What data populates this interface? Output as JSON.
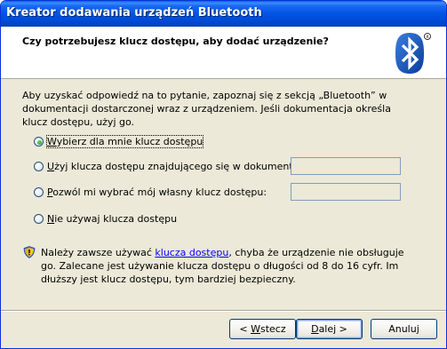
{
  "window": {
    "title": "Kreator dodawania urządzeń Bluetooth"
  },
  "header": {
    "title": "Czy potrzebujesz klucz dostępu, aby dodać urządzenie?",
    "logo_icon": "bluetooth-logo-icon"
  },
  "intro": "Aby uzyskać odpowiedź na to pytanie, zapoznaj się z sekcją „Bluetooth” w dokumentacji dostarczonej wraz z urządzeniem. Jeśli dokumentacja określa klucz dostępu, użyj go.",
  "options": [
    {
      "mnemonic": "W",
      "rest": "ybierz dla mnie klucz dostępu",
      "checked": true
    },
    {
      "mnemonic": "U",
      "rest": "żyj klucza dostępu znajdującego się w dokumentacji:",
      "checked": false,
      "input_value": ""
    },
    {
      "mnemonic": "P",
      "rest": "ozwól mi wybrać mój własny klucz dostępu:",
      "checked": false,
      "input_value": ""
    },
    {
      "mnemonic": "N",
      "rest": "ie używaj klucza dostępu",
      "checked": false
    }
  ],
  "warning": {
    "icon": "security-shield-warning-icon",
    "before": "Należy zawsze używać ",
    "link": "klucza dostępu",
    "after": ", chyba że urządzenie nie obsługuje go. Zalecane jest używanie klucza dostępu o długości od 8 do 16 cyfr. Im dłuższy jest klucz dostępu, tym bardziej bezpieczny."
  },
  "buttons": {
    "back": {
      "prefix": "< ",
      "mnemonic": "W",
      "rest": "stecz"
    },
    "next": {
      "mnemonic": "D",
      "rest": "alej >"
    },
    "cancel": {
      "label": "Anuluj"
    }
  }
}
